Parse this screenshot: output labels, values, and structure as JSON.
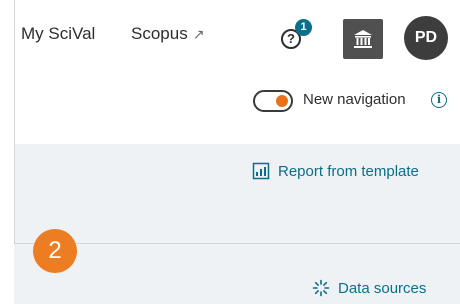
{
  "nav": {
    "my_scival": "My SciVal",
    "scopus": "Scopus",
    "scopus_icon": "external-link-icon"
  },
  "header": {
    "help_glyph": "?",
    "notification_count": "1",
    "institution_icon": "institution-icon",
    "avatar_initials": "PD"
  },
  "toggle": {
    "label": "New navigation",
    "state": "on",
    "info_glyph": "i"
  },
  "actions": {
    "report_from_template": "Report from template",
    "report_icon": "report-chart-icon",
    "data_sources": "Data sources",
    "data_sources_icon": "loading-spinner-icon"
  },
  "callout": {
    "step_number": "2"
  },
  "colors": {
    "accent_orange": "#ed7d23",
    "link_teal": "#0b6e8a",
    "panel_bg": "#eef2f5",
    "dark_button": "#505050"
  }
}
